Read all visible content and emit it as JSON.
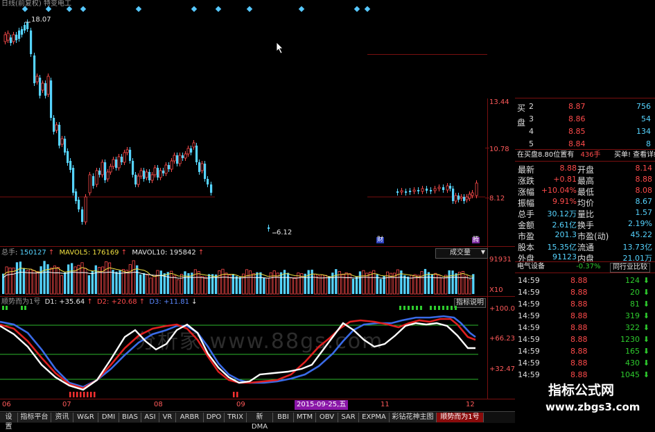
{
  "title": "日线(前复权) 特变电工",
  "price_chart": {
    "high_label": "18.07",
    "low_label": "6.12",
    "axis_ticks": [
      "13.44",
      "10.78",
      "8.12"
    ],
    "markers": [
      "财",
      "腾"
    ]
  },
  "volume_pane": {
    "total_label": "总手",
    "total_value": "150127",
    "mavol5_label": "MAVOL5",
    "mavol5_value": "176169",
    "mavol10_label": "MAVOL10",
    "mavol10_value": "195842",
    "dropdown": "成交量",
    "axis_ticks": [
      "91931",
      "X10"
    ]
  },
  "indicator_pane": {
    "name": "顺势而为1号",
    "d1_label": "D1",
    "d1_value": "+35.64",
    "d2_label": "D2",
    "d2_value": "+20.68",
    "d3_label": "D3",
    "d3_value": "+11.81",
    "help_button": "指标说明",
    "axis_ticks": [
      "+100.0",
      "+66.23",
      "+32.47"
    ],
    "watermark": "分析家 www.88gs.com"
  },
  "x_axis": {
    "labels": [
      "06",
      "07",
      "08",
      "09",
      "11",
      "12"
    ],
    "highlight_date": "2015-09-25,五"
  },
  "bottom_tabs": [
    "设置",
    "指标平台",
    "资讯",
    "W&R",
    "DMI",
    "BIAS",
    "ASI",
    "VR",
    "ARBR",
    "DPO",
    "TRIX",
    "新DMA",
    "BBI",
    "MTM",
    "OBV",
    "SAR",
    "EXPMA",
    "彩钻花神主图",
    "顺势而为1号"
  ],
  "active_tab": "顺势而为1号",
  "quote": {
    "buy_label": "买盘",
    "bids": [
      {
        "level": "2",
        "price": "8.87",
        "vol": "756"
      },
      {
        "level": "3",
        "price": "8.86",
        "vol": "54"
      },
      {
        "level": "4",
        "price": "8.85",
        "vol": "134"
      },
      {
        "level": "5",
        "price": "8.84",
        "vol": "8"
      }
    ],
    "order_info": "在买盘8.80位置有",
    "order_qty": "436手",
    "order_link": "买单! 查看详细",
    "stats": [
      {
        "l1": "最新",
        "v1": "8.88",
        "l2": "开盘",
        "v2": "8.14"
      },
      {
        "l1": "涨跌",
        "v1": "+0.81",
        "l2": "最高",
        "v2": "8.88"
      },
      {
        "l1": "涨幅",
        "v1": "+10.04%",
        "l2": "最低",
        "v2": "8.08"
      },
      {
        "l1": "振幅",
        "v1": "9.91%",
        "l2": "均价",
        "v2": "8.67"
      },
      {
        "l1": "总手",
        "v1": "30.12万",
        "l2": "量比",
        "v2": "1.57"
      },
      {
        "l1": "金额",
        "v1": "2.61亿",
        "l2": "换手",
        "v2": "2.19%"
      },
      {
        "l1": "市盈",
        "v1": "201.3",
        "l2": "市盈(动)",
        "v2": "45.22"
      },
      {
        "l1": "股本",
        "v1": "15.35亿",
        "l2": "流通",
        "v2": "13.73亿"
      },
      {
        "l1": "外盘",
        "v1": "91123",
        "l2": "内盘",
        "v2": "21.01万"
      }
    ],
    "sector": "电气设备",
    "sector_change": "-0.37%",
    "compare_button": "同行业比较",
    "ticks": [
      {
        "time": "14:59",
        "price": "8.88",
        "vol": "124"
      },
      {
        "time": "14:59",
        "price": "8.88",
        "vol": "20"
      },
      {
        "time": "14:59",
        "price": "8.88",
        "vol": "81"
      },
      {
        "time": "14:59",
        "price": "8.88",
        "vol": "319"
      },
      {
        "time": "14:59",
        "price": "8.88",
        "vol": "322"
      },
      {
        "time": "14:59",
        "price": "8.88",
        "vol": "1230"
      },
      {
        "time": "14:59",
        "price": "8.88",
        "vol": "165"
      },
      {
        "time": "14:59",
        "price": "8.88",
        "vol": "430"
      },
      {
        "time": "14:59",
        "price": "8.88",
        "vol": "1045"
      }
    ],
    "logo_text": "指标公式网",
    "logo_url": "www.zbgs3.com"
  },
  "colors": {
    "up": "#ff4b4b",
    "down": "#56d4ff",
    "grid": "#7a1010",
    "d1": "#ffffff",
    "d2": "#e02020",
    "d3": "#3a6be8"
  }
}
